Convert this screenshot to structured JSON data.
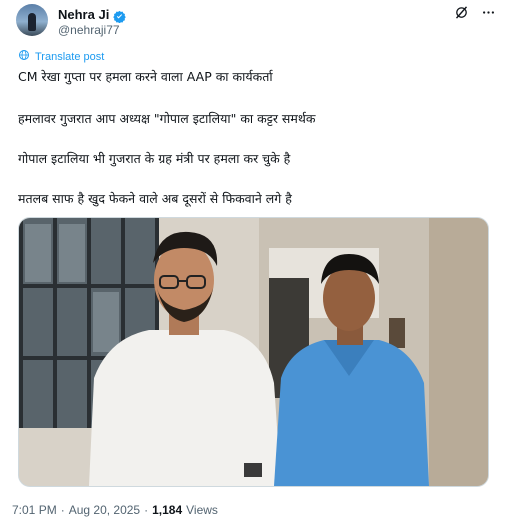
{
  "author": {
    "name": "Nehra Ji",
    "handle": "@nehraji77"
  },
  "translate_label": "Translate post",
  "post_lines": [
    "CM रेखा गुप्ता पर हमला करने वाला AAP का कार्यकर्ता",
    "हमलावर गुजरात आप अध्यक्ष \"गोपाल इटालिया\" का कट्टर समर्थक",
    "गोपाल इटालिया भी गुजरात के ग्रह मंत्री पर हमला कर चुके है",
    "मतलब साफ है खुद फेकने वाले अब दूसरों से फिकवाने लगे है"
  ],
  "footer": {
    "time": "7:01 PM",
    "date": "Aug 20, 2025",
    "separator": "·",
    "views_count": "1,184",
    "views_label": "Views"
  },
  "colors": {
    "accent": "#1d9bf0",
    "text": "#0f1419",
    "muted": "#536471",
    "border": "#cfd9de"
  },
  "icons": [
    "verified-badge-icon",
    "grok-icon",
    "more-icon",
    "translate-globe-icon"
  ]
}
